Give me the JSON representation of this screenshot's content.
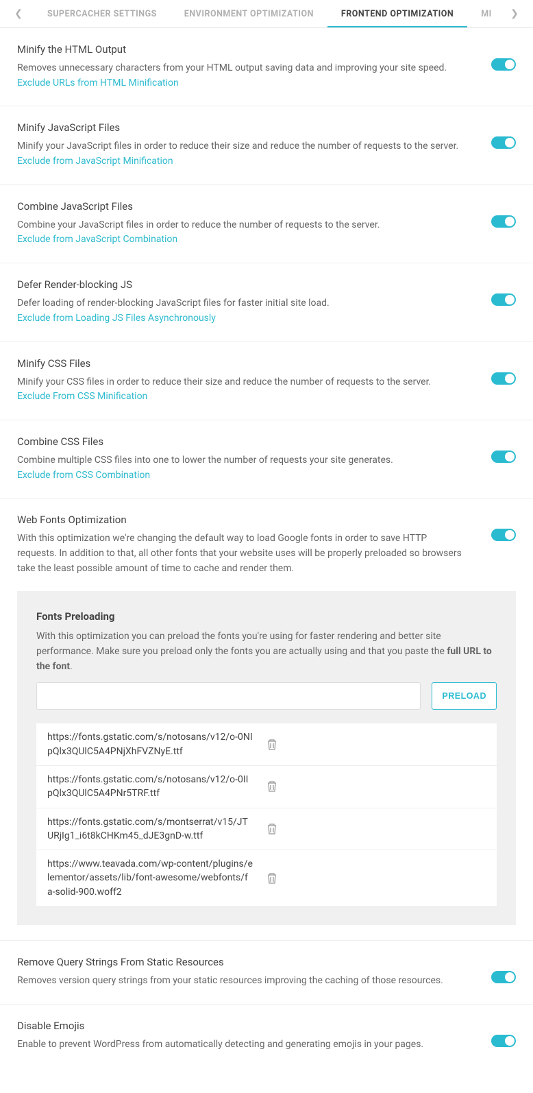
{
  "tabs": {
    "items": [
      {
        "label": "SUPERCACHER SETTINGS",
        "active": false
      },
      {
        "label": "ENVIRONMENT OPTIMIZATION",
        "active": false
      },
      {
        "label": "FRONTEND OPTIMIZATION",
        "active": true
      },
      {
        "label": "MI",
        "active": false
      }
    ]
  },
  "sections": {
    "minify_html": {
      "title": "Minify the HTML Output",
      "desc": "Removes unnecessary characters from your HTML output saving data and improving your site speed. ",
      "link": "Exclude URLs from HTML Minification"
    },
    "minify_js": {
      "title": "Minify JavaScript Files",
      "desc": "Minify your JavaScript files in order to reduce their size and reduce the number of requests to the server. ",
      "link": "Exclude from JavaScript Minification"
    },
    "combine_js": {
      "title": "Combine JavaScript Files",
      "desc": "Combine your JavaScript files in order to reduce the number of requests to the server.",
      "link": "Exclude from JavaScript Combination"
    },
    "defer_js": {
      "title": "Defer Render-blocking JS",
      "desc": "Defer loading of render-blocking JavaScript files for faster initial site load.",
      "link": "Exclude from Loading JS Files Asynchronously"
    },
    "minify_css": {
      "title": "Minify CSS Files",
      "desc": "Minify your CSS files in order to reduce their size and reduce the number of requests to the server. ",
      "link": "Exclude From CSS Minification"
    },
    "combine_css": {
      "title": "Combine CSS Files",
      "desc": "Combine multiple CSS files into one to lower the number of requests your site generates. ",
      "link": "Exclude from CSS Combination"
    },
    "webfonts": {
      "title": "Web Fonts Optimization",
      "desc": "With this optimization we're changing the default way to load Google fonts in order to save HTTP requests. In addition to that, all other fonts that your website uses will be properly preloaded so browsers take the least possible amount of time to cache and render them."
    },
    "query_strings": {
      "title": "Remove Query Strings From Static Resources",
      "desc": "Removes version query strings from your static resources improving the caching of those resources."
    },
    "emojis": {
      "title": "Disable Emojis",
      "desc": "Enable to prevent WordPress from automatically detecting and generating emojis in your pages."
    }
  },
  "fonts_preloading": {
    "heading": "Fonts Preloading",
    "desc_pre": "With this optimization you can preload the fonts you're using for faster rendering and better site performance. Make sure you preload only the fonts you are actually using and that you paste the ",
    "desc_bold": "full URL to the font",
    "desc_post": ".",
    "button": "PRELOAD",
    "input_value": "",
    "items": [
      "https://fonts.gstatic.com/s/notosans/v12/o-0NIpQlx3QUlC5A4PNjXhFVZNyE.ttf",
      "https://fonts.gstatic.com/s/notosans/v12/o-0IIpQlx3QUlC5A4PNr5TRF.ttf",
      "https://fonts.gstatic.com/s/montserrat/v15/JTURjIg1_i6t8kCHKm45_dJE3gnD-w.ttf",
      "https://www.teavada.com/wp-content/plugins/elementor/assets/lib/font-awesome/webfonts/fa-solid-900.woff2"
    ]
  }
}
